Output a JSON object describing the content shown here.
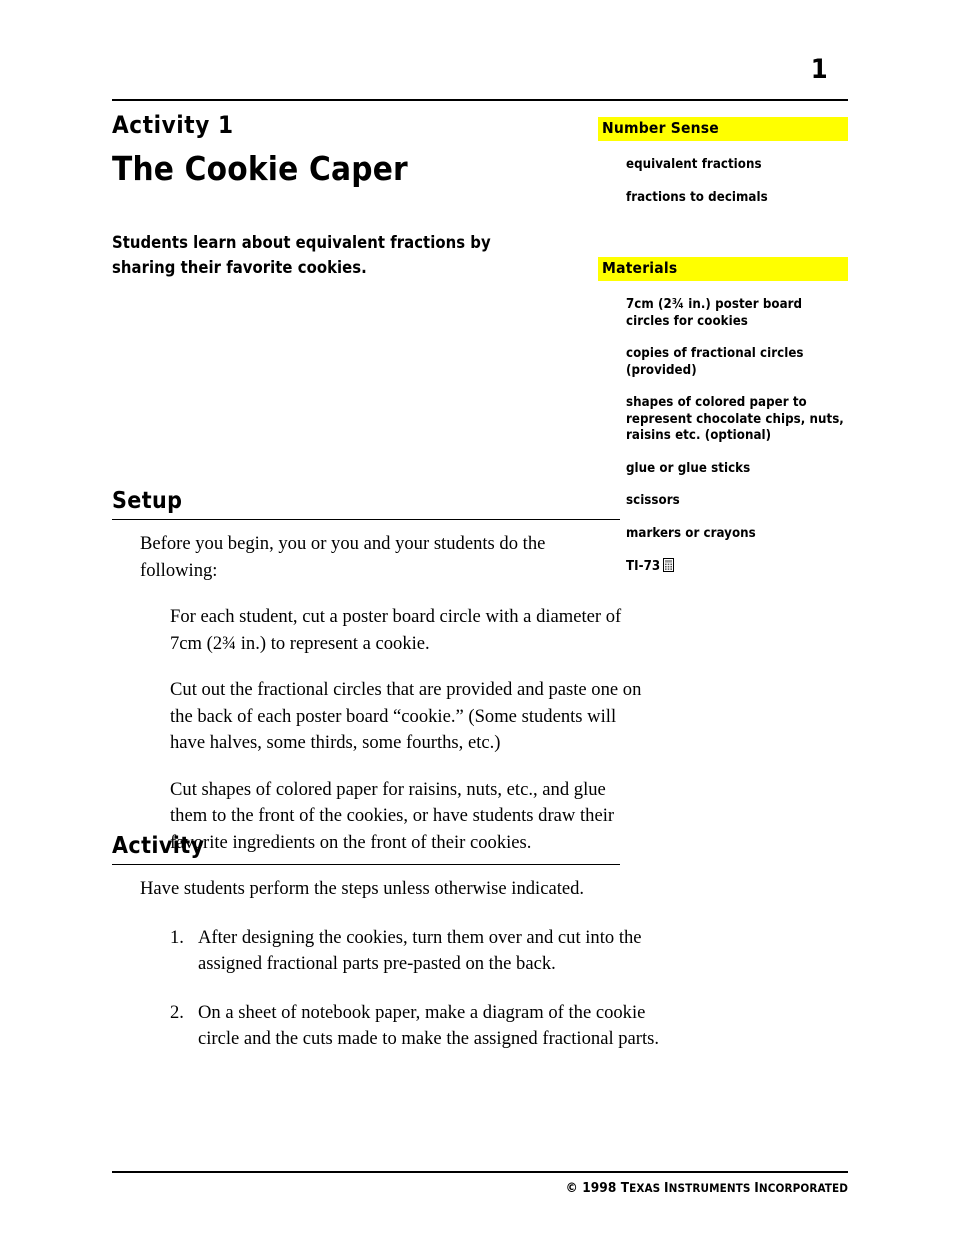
{
  "header": {
    "page_number": "1",
    "rule": true
  },
  "left": {
    "activity_label": "Activity 1",
    "title": "The Cookie Caper",
    "intro": "Students learn about equivalent fractions by sharing their favorite cookies."
  },
  "sidebar": {
    "blocks": [
      {
        "heading": "Number Sense",
        "items": [
          "equivalent fractions",
          "fractions to decimals"
        ]
      },
      {
        "heading": "Materials",
        "items": [
          "7cm (2¾ in.) poster board circles for cookies",
          "copies of fractional circles (provided)",
          "shapes of colored paper to represent chocolate chips, nuts, raisins etc. (optional)",
          "glue or glue sticks",
          "scissors",
          "markers or crayons",
          "TI-73"
        ],
        "last_item_icon": "calculator-icon"
      }
    ],
    "highlight_color": "#FFFF00"
  },
  "setup": {
    "heading": "Setup",
    "lead": "Before you begin, you or you and your students do the following:",
    "steps": [
      "For each student, cut a poster board circle with a diameter of 7cm (2¾ in.) to represent a cookie.",
      "Cut out the fractional circles that are provided and paste one on the back of each poster board “cookie.” (Some students will have halves, some thirds, some fourths, etc.)",
      "Cut shapes of colored paper for raisins, nuts, etc., and glue them to the front of  the cookies, or have students draw their favorite ingredients on the front of their cookies."
    ]
  },
  "activity": {
    "heading": "Activity",
    "lead": "Have students perform the steps unless otherwise indicated.",
    "steps": [
      {
        "number": "1.",
        "text": "After designing the cookies, turn them over and cut into the assigned fractional parts pre-pasted on the back."
      },
      {
        "number": "2.",
        "text": "On a sheet of notebook paper, make a diagram of the cookie circle and the cuts made to make the assigned fractional parts."
      }
    ]
  },
  "footer": {
    "copyright_symbol": "©",
    "year": "1998",
    "company_first": "T",
    "company_rest": "EXAS ",
    "company_i": "I",
    "company_instruments": "NSTRUMENTS ",
    "company_inc_first": "I",
    "company_inc_rest": "NCORPORATED",
    "full_text": "© 1998 Texas Instruments Incorporated"
  }
}
